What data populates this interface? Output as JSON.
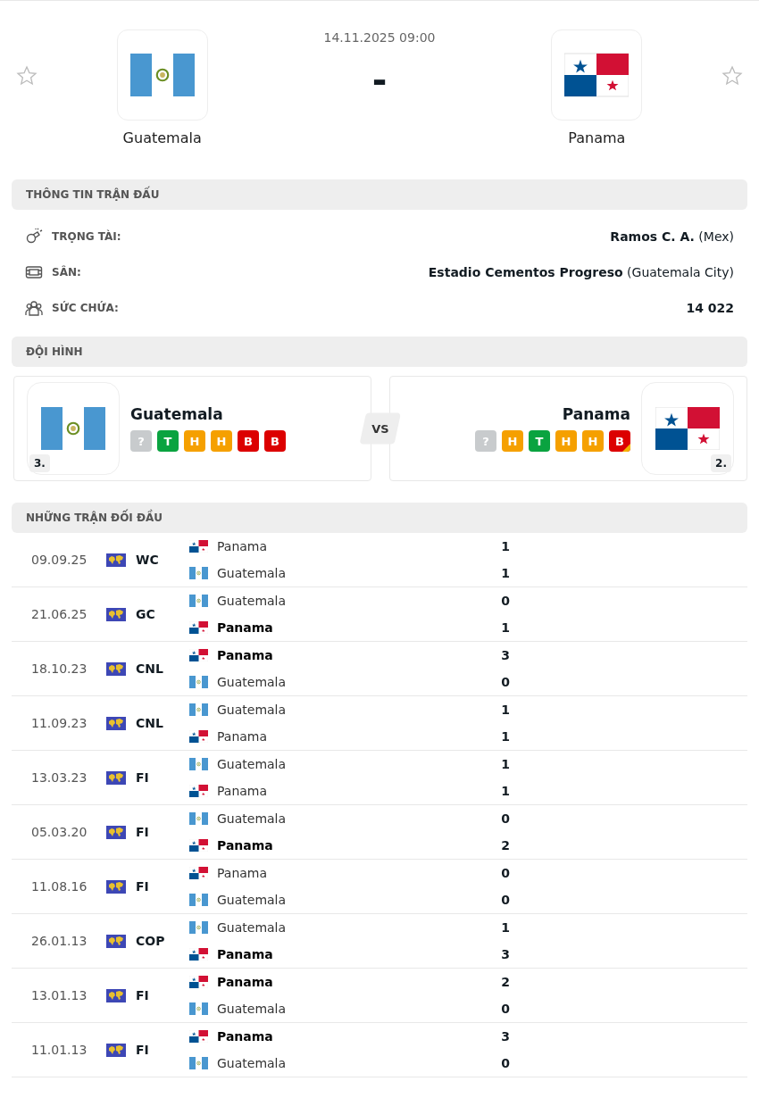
{
  "header": {
    "datetime": "14.11.2025 09:00",
    "score": "-",
    "home": {
      "name": "Guatemala",
      "kind": "guatemala",
      "favorite": false
    },
    "away": {
      "name": "Panama",
      "kind": "panama",
      "favorite": false
    }
  },
  "info": {
    "title": "THÔNG TIN TRẬN ĐẤU",
    "rows": [
      {
        "kind": "referee",
        "label": "TRỌNG TÀI:",
        "value": "Ramos C. A.",
        "note": "(Mex)"
      },
      {
        "kind": "stadium",
        "label": "SÂN:",
        "value": "Estadio Cementos Progreso",
        "note": "(Guatemala City)"
      },
      {
        "kind": "capacity",
        "label": "SỨC CHỨA:",
        "value": "14 022"
      }
    ]
  },
  "lineup": {
    "title": "ĐỘI HÌNH",
    "vs": "VS",
    "teams": [
      {
        "name": "Guatemala",
        "kind": "guatemala",
        "rank": "3.",
        "form": [
          {
            "result": "?",
            "kind": "unknown",
            "marked": false
          },
          {
            "result": "T",
            "kind": "win",
            "marked": false
          },
          {
            "result": "H",
            "kind": "draw",
            "marked": false
          },
          {
            "result": "H",
            "kind": "draw",
            "marked": false
          },
          {
            "result": "B",
            "kind": "loss",
            "marked": false
          },
          {
            "result": "B",
            "kind": "loss",
            "marked": false
          }
        ]
      },
      {
        "name": "Panama",
        "kind": "panama",
        "rank": "2.",
        "form": [
          {
            "result": "?",
            "kind": "unknown",
            "marked": false
          },
          {
            "result": "H",
            "kind": "draw",
            "marked": false
          },
          {
            "result": "T",
            "kind": "win",
            "marked": false
          },
          {
            "result": "H",
            "kind": "draw",
            "marked": false
          },
          {
            "result": "H",
            "kind": "draw",
            "marked": false
          },
          {
            "result": "B",
            "kind": "loss",
            "marked": true
          }
        ]
      }
    ]
  },
  "h2h": {
    "title": "NHỮNG TRẬN ĐỐI ĐẦU",
    "matches": [
      {
        "date": "09.09.25",
        "competition": "WC",
        "teams": [
          {
            "name": "Panama",
            "kind": "panama",
            "score": "1",
            "winner": false
          },
          {
            "name": "Guatemala",
            "kind": "guatemala",
            "score": "1",
            "winner": false
          }
        ]
      },
      {
        "date": "21.06.25",
        "competition": "GC",
        "teams": [
          {
            "name": "Guatemala",
            "kind": "guatemala",
            "score": "0",
            "winner": false
          },
          {
            "name": "Panama",
            "kind": "panama",
            "score": "1",
            "winner": true
          }
        ]
      },
      {
        "date": "18.10.23",
        "competition": "CNL",
        "teams": [
          {
            "name": "Panama",
            "kind": "panama",
            "score": "3",
            "winner": true
          },
          {
            "name": "Guatemala",
            "kind": "guatemala",
            "score": "0",
            "winner": false
          }
        ]
      },
      {
        "date": "11.09.23",
        "competition": "CNL",
        "teams": [
          {
            "name": "Guatemala",
            "kind": "guatemala",
            "score": "1",
            "winner": false
          },
          {
            "name": "Panama",
            "kind": "panama",
            "score": "1",
            "winner": false
          }
        ]
      },
      {
        "date": "13.03.23",
        "competition": "FI",
        "teams": [
          {
            "name": "Guatemala",
            "kind": "guatemala",
            "score": "1",
            "winner": false
          },
          {
            "name": "Panama",
            "kind": "panama",
            "score": "1",
            "winner": false
          }
        ]
      },
      {
        "date": "05.03.20",
        "competition": "FI",
        "teams": [
          {
            "name": "Guatemala",
            "kind": "guatemala",
            "score": "0",
            "winner": false
          },
          {
            "name": "Panama",
            "kind": "panama",
            "score": "2",
            "winner": true
          }
        ]
      },
      {
        "date": "11.08.16",
        "competition": "FI",
        "teams": [
          {
            "name": "Panama",
            "kind": "panama",
            "score": "0",
            "winner": false
          },
          {
            "name": "Guatemala",
            "kind": "guatemala",
            "score": "0",
            "winner": false
          }
        ]
      },
      {
        "date": "26.01.13",
        "competition": "COP",
        "teams": [
          {
            "name": "Guatemala",
            "kind": "guatemala",
            "score": "1",
            "winner": false
          },
          {
            "name": "Panama",
            "kind": "panama",
            "score": "3",
            "winner": true
          }
        ]
      },
      {
        "date": "13.01.13",
        "competition": "FI",
        "teams": [
          {
            "name": "Panama",
            "kind": "panama",
            "score": "2",
            "winner": true
          },
          {
            "name": "Guatemala",
            "kind": "guatemala",
            "score": "0",
            "winner": false
          }
        ]
      },
      {
        "date": "11.01.13",
        "competition": "FI",
        "teams": [
          {
            "name": "Panama",
            "kind": "panama",
            "score": "3",
            "winner": true
          },
          {
            "name": "Guatemala",
            "kind": "guatemala",
            "score": "0",
            "winner": false
          }
        ]
      }
    ]
  }
}
